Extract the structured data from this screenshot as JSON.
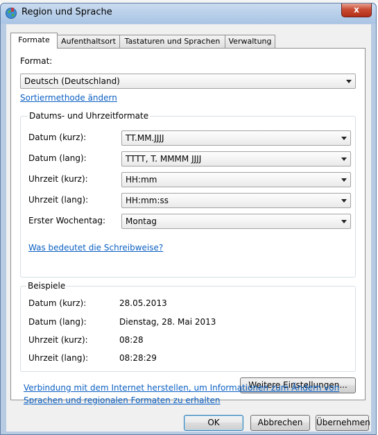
{
  "window": {
    "title": "Region und Sprache",
    "close_label": "x"
  },
  "tabs": [
    {
      "label": "Formate"
    },
    {
      "label": "Aufenthaltsort"
    },
    {
      "label": "Tastaturen und Sprachen"
    },
    {
      "label": "Verwaltung"
    }
  ],
  "format": {
    "label": "Format:",
    "value": "Deutsch (Deutschland)",
    "sort_link": "Sortiermethode ändern"
  },
  "datetime": {
    "title": "Datums- und Uhrzeitformate",
    "rows": [
      {
        "label": "Datum (kurz):",
        "value": "TT.MM.JJJJ"
      },
      {
        "label": "Datum (lang):",
        "value": "TTTT, T. MMMM JJJJ"
      },
      {
        "label": "Uhrzeit (kurz):",
        "value": "HH:mm"
      },
      {
        "label": "Uhrzeit (lang):",
        "value": "HH:mm:ss"
      },
      {
        "label": "Erster Wochentag:",
        "value": "Montag"
      }
    ],
    "help_link": "Was bedeutet die Schreibweise?"
  },
  "examples": {
    "title": "Beispiele",
    "rows": [
      {
        "label": "Datum (kurz):",
        "value": "28.05.2013"
      },
      {
        "label": "Datum (lang):",
        "value": "Dienstag, 28. Mai 2013"
      },
      {
        "label": "Uhrzeit (kurz):",
        "value": "08:28"
      },
      {
        "label": "Uhrzeit (lang):",
        "value": "08:28:29"
      }
    ]
  },
  "more_settings_button": "Weitere Einstellungen...",
  "internet_link": {
    "line1": "Verbindung mit dem Internet herstellen, um Informationen zum Ändern von",
    "line2": "Sprachen und regionalen Formaten zu erhalten"
  },
  "buttons": {
    "ok": "OK",
    "cancel": "Abbrechen",
    "apply": "Übernehmen"
  },
  "icons": {
    "title": "globe-icon",
    "dropdown": "chevron-down-icon"
  },
  "colors": {
    "link": "#0a5fc2",
    "titlebar": "#b7cbe3",
    "close": "#c94c33"
  }
}
